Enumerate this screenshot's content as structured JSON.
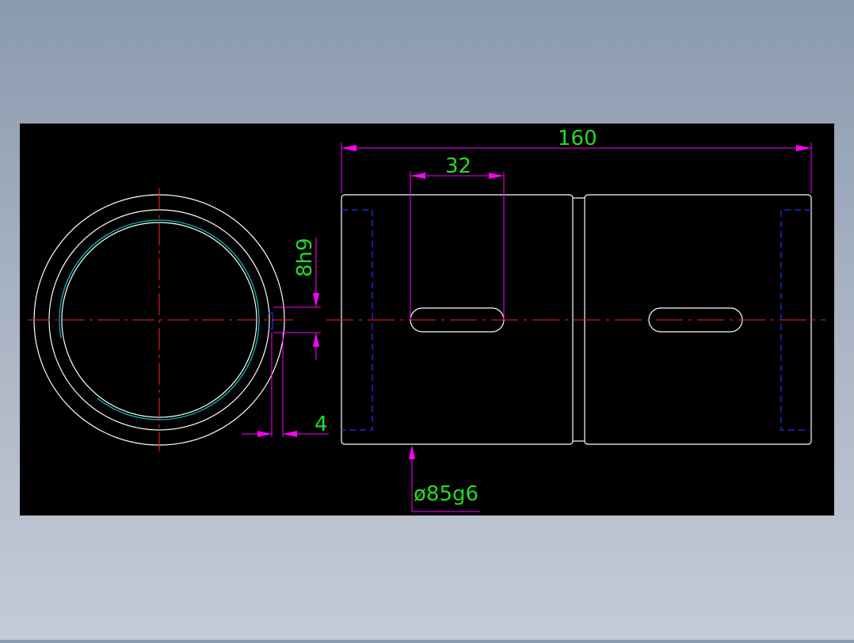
{
  "drawing": {
    "background": "#000000",
    "colors": {
      "outline": "#ffffff",
      "centerline": "#ff2020",
      "dimension": "#ff00ff",
      "dimension_text": "#22dd22",
      "hidden": "#2233ff",
      "thread": "#00c8c8"
    },
    "dimensions": {
      "total_length": "160",
      "slot_length": "32",
      "slot_width": "8h9",
      "wall": "4",
      "diameter": "ø85g6"
    }
  }
}
